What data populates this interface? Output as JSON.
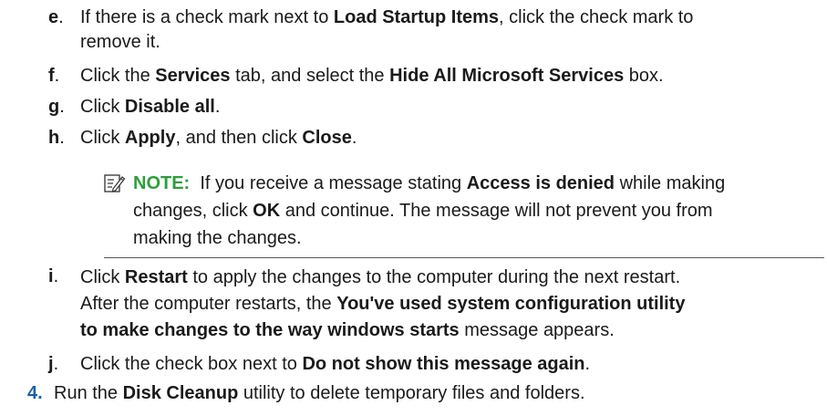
{
  "steps": {
    "e": {
      "letter": "e",
      "t1": "If there is a check mark next to ",
      "b1": "Load Startup Items",
      "t2": ", click the check mark to",
      "t3": "remove it."
    },
    "f": {
      "letter": "f",
      "t1": "Click the ",
      "b1": "Services",
      "t2": " tab, and select the ",
      "b2": "Hide All Microsoft Services",
      "t3": " box."
    },
    "g": {
      "letter": "g",
      "t1": "Click ",
      "b1": "Disable all",
      "t2": "."
    },
    "h": {
      "letter": "h",
      "t1": "Click ",
      "b1": "Apply",
      "t2": ", and then click ",
      "b2": "Close",
      "t3": "."
    },
    "i": {
      "letter": "i",
      "t1": "Click ",
      "b1": "Restart",
      "t2": " to apply the changes to the computer during the next restart.",
      "t3": "After the computer restarts, the ",
      "b2": "You've used system configuration utility",
      "b3": "to make changes to the way windows starts",
      "t4": " message appears."
    },
    "j": {
      "letter": "j",
      "t1": "Click the check box next to ",
      "b1": "Do not show this message again",
      "t2": "."
    },
    "four": {
      "number": "4.",
      "t1": "Run the ",
      "b1": "Disk Cleanup",
      "t2": " utility to delete temporary files and folders."
    }
  },
  "note": {
    "label": "NOTE:",
    "icon": "note-pencil-icon",
    "t1": "If you receive a message stating ",
    "b1": "Access is denied",
    "t2": " while making",
    "t3": "changes, click ",
    "b2": "OK",
    "t4": " and continue. The message will not prevent you from",
    "t5": "making the changes."
  },
  "colors": {
    "note_label": "#2e9e3a",
    "step_number": "#1f5fa8",
    "text": "#1a1a1a"
  }
}
